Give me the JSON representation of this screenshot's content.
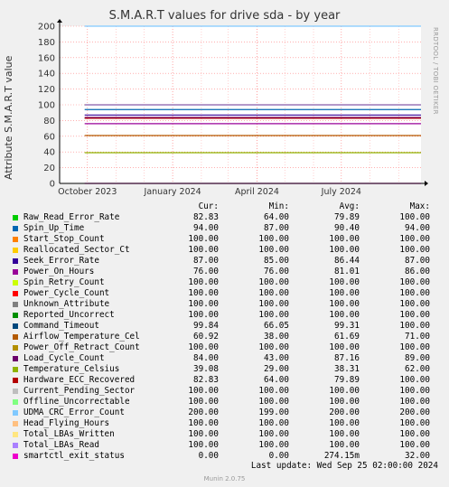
{
  "chart_data": {
    "type": "line",
    "title": "S.M.A.R.T values for drive sda - by year",
    "ylabel": "Attribute S.M.A.R.T value",
    "ylim": [
      0,
      200
    ],
    "yticks": [
      "0",
      "20",
      "40",
      "60",
      "80",
      "100",
      "120",
      "140",
      "160",
      "180",
      "200"
    ],
    "xticks": [
      {
        "label": "October 2023",
        "date": "2023-10-01"
      },
      {
        "label": "January 2024",
        "date": "2024-01-01"
      },
      {
        "label": "April 2024",
        "date": "2024-04-01"
      },
      {
        "label": "July 2024",
        "date": "2024-07-01"
      }
    ],
    "xrange": [
      "2023-09-01",
      "2024-09-25"
    ],
    "grid": true,
    "series_start": "2023-09-28",
    "columns": [
      "Cur:",
      "Min:",
      "Avg:",
      "Max:"
    ],
    "series": [
      {
        "name": "Raw_Read_Error_Rate",
        "color": "#00cc00",
        "cur": "82.83",
        "min": "64.00",
        "avg": "79.89",
        "max": "100.00"
      },
      {
        "name": "Spin_Up_Time",
        "color": "#0066b3",
        "cur": "94.00",
        "min": "87.00",
        "avg": "90.40",
        "max": "94.00"
      },
      {
        "name": "Start_Stop_Count",
        "color": "#ff8000",
        "cur": "100.00",
        "min": "100.00",
        "avg": "100.00",
        "max": "100.00"
      },
      {
        "name": "Reallocated_Sector_Ct",
        "color": "#ffcc00",
        "cur": "100.00",
        "min": "100.00",
        "avg": "100.00",
        "max": "100.00"
      },
      {
        "name": "Seek_Error_Rate",
        "color": "#330099",
        "cur": "87.00",
        "min": "85.00",
        "avg": "86.44",
        "max": "87.00"
      },
      {
        "name": "Power_On_Hours",
        "color": "#990099",
        "cur": "76.00",
        "min": "76.00",
        "avg": "81.01",
        "max": "86.00"
      },
      {
        "name": "Spin_Retry_Count",
        "color": "#ccff00",
        "cur": "100.00",
        "min": "100.00",
        "avg": "100.00",
        "max": "100.00"
      },
      {
        "name": "Power_Cycle_Count",
        "color": "#ff0000",
        "cur": "100.00",
        "min": "100.00",
        "avg": "100.00",
        "max": "100.00"
      },
      {
        "name": "Unknown_Attribute",
        "color": "#808080",
        "cur": "100.00",
        "min": "100.00",
        "avg": "100.00",
        "max": "100.00"
      },
      {
        "name": "Reported_Uncorrect",
        "color": "#008f00",
        "cur": "100.00",
        "min": "100.00",
        "avg": "100.00",
        "max": "100.00"
      },
      {
        "name": "Command_Timeout",
        "color": "#00487d",
        "cur": "99.84",
        "min": "66.05",
        "avg": "99.31",
        "max": "100.00"
      },
      {
        "name": "Airflow_Temperature_Cel",
        "color": "#b35a00",
        "cur": "60.92",
        "min": "38.00",
        "avg": "61.69",
        "max": "71.00"
      },
      {
        "name": "Power_Off_Retract_Count",
        "color": "#b38f00",
        "cur": "100.00",
        "min": "100.00",
        "avg": "100.00",
        "max": "100.00"
      },
      {
        "name": "Load_Cycle_Count",
        "color": "#6b006b",
        "cur": "84.00",
        "avg": "87.16",
        "min": "43.00",
        "max": "89.00"
      },
      {
        "name": "Temperature_Celsius",
        "color": "#8fb300",
        "cur": "39.08",
        "min": "29.00",
        "avg": "38.31",
        "max": "62.00"
      },
      {
        "name": "Hardware_ECC_Recovered",
        "color": "#b30000",
        "cur": "82.83",
        "min": "64.00",
        "avg": "79.89",
        "max": "100.00"
      },
      {
        "name": "Current_Pending_Sector",
        "color": "#bebebe",
        "cur": "100.00",
        "min": "100.00",
        "avg": "100.00",
        "max": "100.00"
      },
      {
        "name": "Offline_Uncorrectable",
        "color": "#80ff80",
        "cur": "100.00",
        "min": "100.00",
        "avg": "100.00",
        "max": "100.00"
      },
      {
        "name": "UDMA_CRC_Error_Count",
        "color": "#80c9ff",
        "cur": "200.00",
        "min": "199.00",
        "avg": "200.00",
        "max": "200.00"
      },
      {
        "name": "Head_Flying_Hours",
        "color": "#ffc080",
        "cur": "100.00",
        "min": "100.00",
        "avg": "100.00",
        "max": "100.00"
      },
      {
        "name": "Total_LBAs_Written",
        "color": "#ffe680",
        "cur": "100.00",
        "min": "100.00",
        "avg": "100.00",
        "max": "100.00"
      },
      {
        "name": "Total_LBAs_Read",
        "color": "#aa80ff",
        "cur": "100.00",
        "min": "100.00",
        "avg": "100.00",
        "max": "100.00"
      },
      {
        "name": "smartctl_exit_status",
        "color": "#ee00cc",
        "cur": "0.00",
        "min": "0.00",
        "avg": "274.15m",
        "max": "32.00"
      }
    ]
  },
  "watermark": "RRDTOOL / TOBI OETIKER",
  "last_update": "Last update: Wed Sep 25 02:00:00 2024",
  "footer": "Munin 2.0.75"
}
